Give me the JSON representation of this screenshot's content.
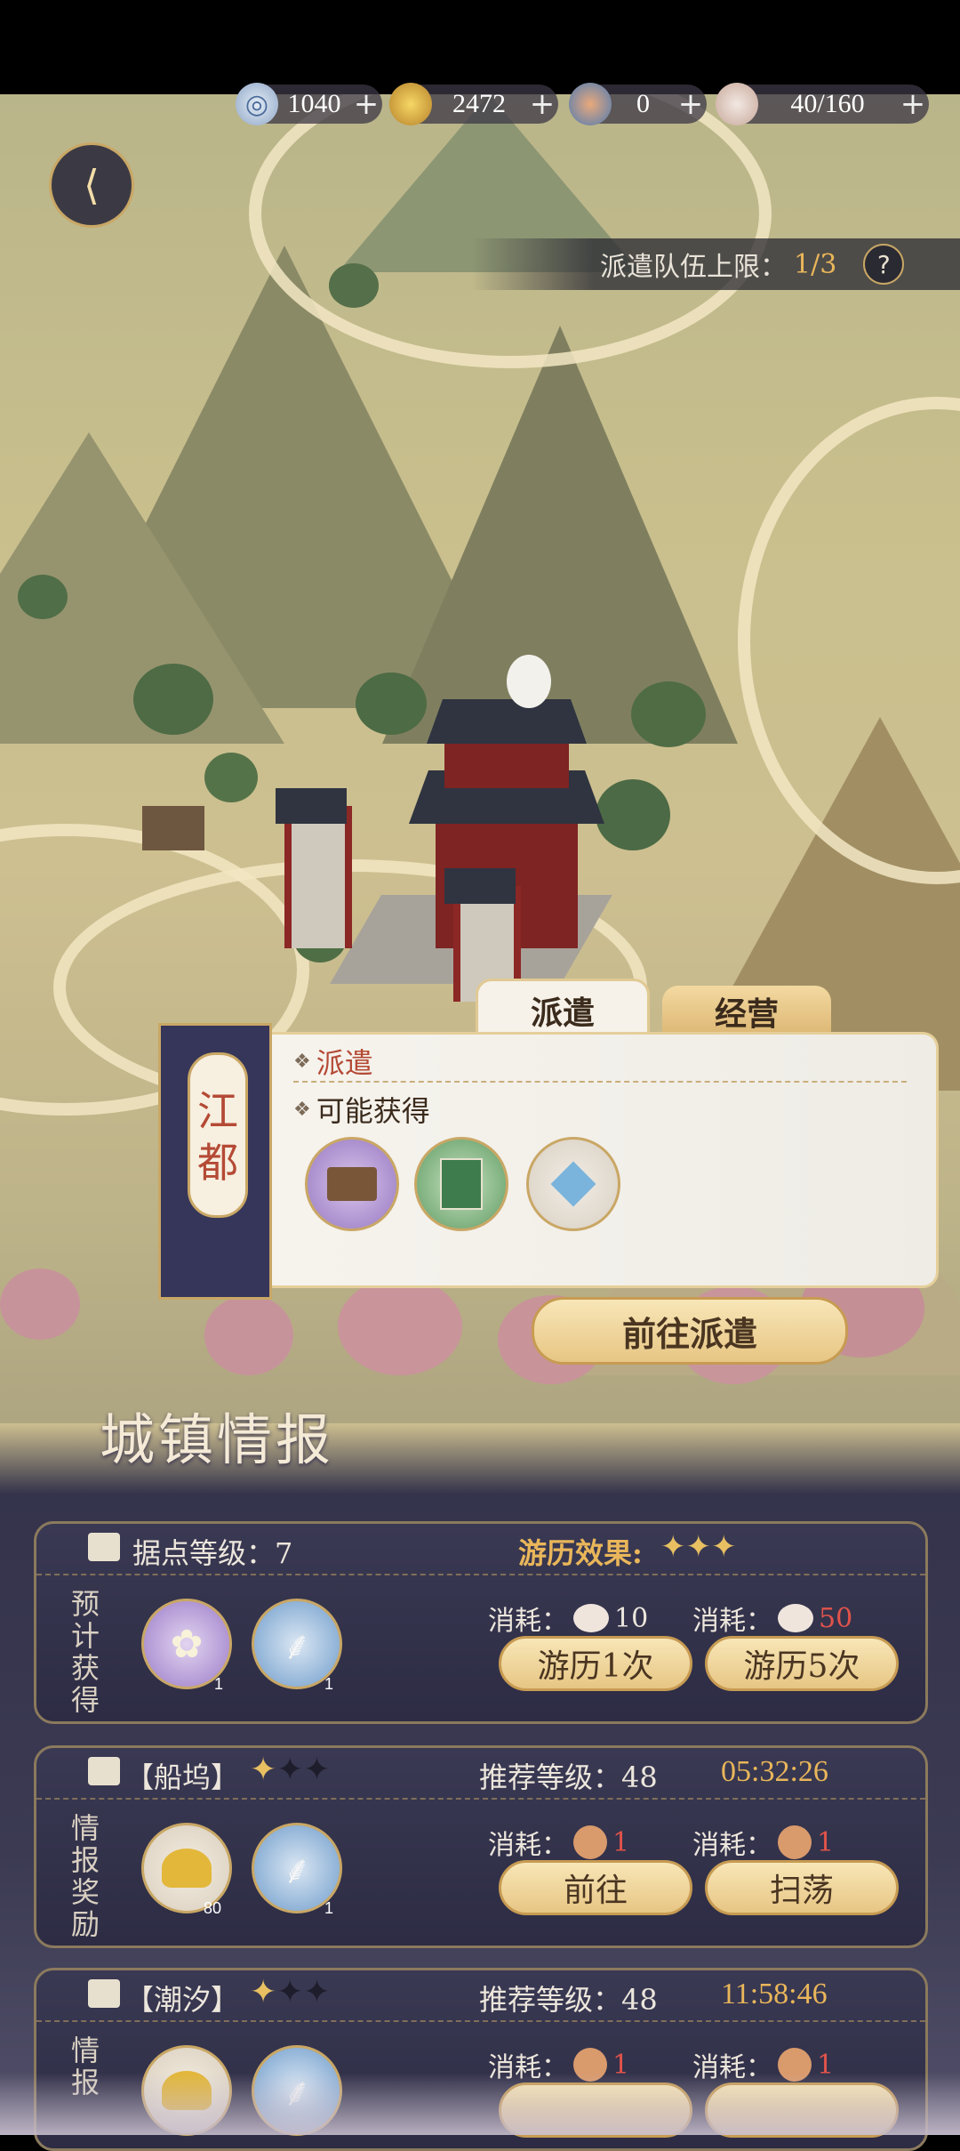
{
  "resources": [
    {
      "icon": "jade-icon",
      "value": "1040"
    },
    {
      "icon": "gold-basket-icon",
      "value": "2472"
    },
    {
      "icon": "fox-token-icon",
      "value": "0"
    },
    {
      "icon": "bowl-icon",
      "value": "40/160"
    }
  ],
  "plus": "+",
  "dispatch_limit": {
    "label": "派遣队伍上限：",
    "value": "1/3",
    "help": "?"
  },
  "city": {
    "name_1": "江",
    "name_2": "都"
  },
  "tabs": {
    "dispatch": "派遣",
    "manage": "经营"
  },
  "panel": {
    "dispatch_title": "派遣",
    "rewards_title": "可能获得",
    "go_button": "前往派遣"
  },
  "section_title": "城镇情报",
  "card1": {
    "level_label": "据点等级：7",
    "effect_label": "游历效果:",
    "side_label": [
      "预",
      "计",
      "获",
      "得"
    ],
    "item1_count": "1",
    "item2_count": "1",
    "cost_label": "消耗：",
    "cost1": "10",
    "cost2": "50",
    "btn1": "游历1次",
    "btn2": "游历5次"
  },
  "card2": {
    "name": "【船坞】",
    "recommend": "推荐等级：48",
    "timer": "05:32:26",
    "side_label": [
      "情",
      "报",
      "奖",
      "励"
    ],
    "item1_count": "80",
    "item2_count": "1",
    "cost_label": "消耗：",
    "cost1": "1",
    "cost2": "1",
    "btn1": "前往",
    "btn2": "扫荡"
  },
  "card3": {
    "name": "【潮汐】",
    "recommend": "推荐等级：48",
    "timer": "11:58:46",
    "side_label": [
      "情",
      "报"
    ],
    "cost_label": "消耗：",
    "cost1": "1",
    "cost2": "1"
  },
  "colors": {
    "accent_gold": "#e9b65a",
    "cost_red": "#e0534a",
    "panel_bg": "#33324a"
  }
}
